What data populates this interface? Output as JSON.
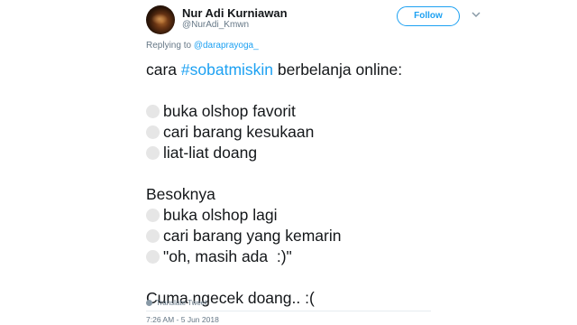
{
  "author": {
    "name": "Nur Adi Kurniawan",
    "handle": "@NurAdi_Kmwn"
  },
  "follow_label": "Follow",
  "replying": {
    "prefix": "Replying to ",
    "mention": "@daraprayoga_"
  },
  "tweet": {
    "intro_pre": "cara ",
    "hashtag": "#sobatmiskin",
    "intro_post": " berbelanja online:",
    "list1": [
      "buka olshop favorit",
      "cari barang kesukaan",
      "liat-liat doang"
    ],
    "besoknya": "Besoknya",
    "list2": [
      "buka olshop lagi",
      "cari barang yang kemarin",
      "\"oh, masih ada  :)\""
    ],
    "closing": "Cuma ngecek doang.. :("
  },
  "translate_label": "Translate Tweet",
  "timestamp": "7:26 AM - 5 Jun 2018",
  "colors": {
    "accent": "#1da1f2",
    "text": "#14171a",
    "muted": "#657786",
    "emoji_placeholder": "#e6e6e6"
  }
}
